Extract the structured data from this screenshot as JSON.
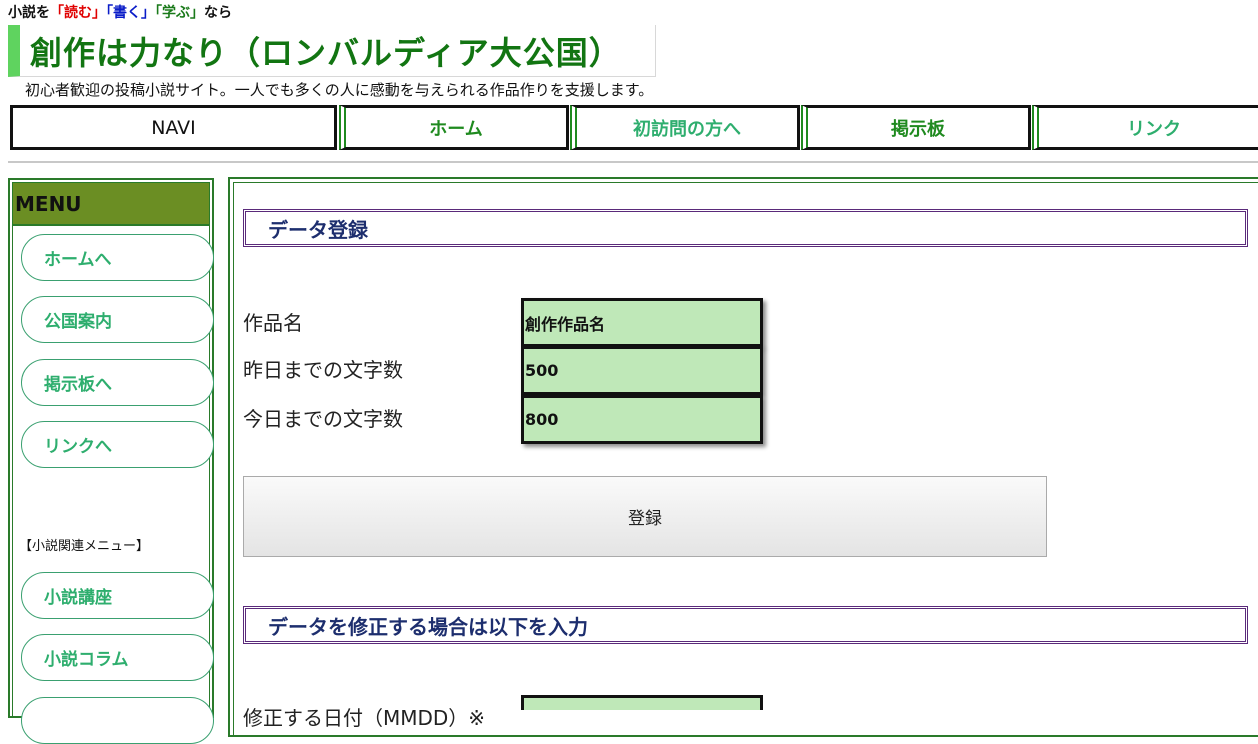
{
  "tagline": {
    "prefix": "小説を",
    "read": "「読む」",
    "write": "「書く」",
    "learn": "「学ぶ」",
    "suffix": "なら"
  },
  "site": {
    "title": "創作は力なり（ロンバルディア大公国）",
    "description": "初心者歓迎の投稿小説サイト。一人でも多くの人に感動を与えられる作品作りを支援します。"
  },
  "nav": {
    "label": "NAVI",
    "items": [
      {
        "label": "ホーム"
      },
      {
        "label": "初訪問の方へ"
      },
      {
        "label": "掲示板"
      },
      {
        "label": "リンク"
      }
    ]
  },
  "sidebar": {
    "menu_title": "MENU",
    "items": [
      {
        "label": "ホームへ"
      },
      {
        "label": "公国案内"
      },
      {
        "label": "掲示板へ"
      },
      {
        "label": "リンクへ"
      }
    ],
    "submenu_title": "【小説関連メニュー】",
    "sub_items": [
      {
        "label": "小説講座"
      },
      {
        "label": "小説コラム"
      }
    ]
  },
  "main": {
    "section1_title": "データ登録",
    "fields": [
      {
        "label": "作品名",
        "value": "創作作品名"
      },
      {
        "label": "昨日までの文字数",
        "value": "500"
      },
      {
        "label": "今日までの文字数",
        "value": "800"
      }
    ],
    "submit_label": "登録",
    "section2_title": "データを修正する場合は以下を入力",
    "fix_field_label": "修正する日付（MMDD）※",
    "fix_field_value": ""
  },
  "colors": {
    "title_green": "#127512",
    "accent_green": "#5fd35f",
    "menu_bg": "#6b8e23",
    "input_bg": "#bfe8b8",
    "section_text": "#1d2e6e"
  }
}
